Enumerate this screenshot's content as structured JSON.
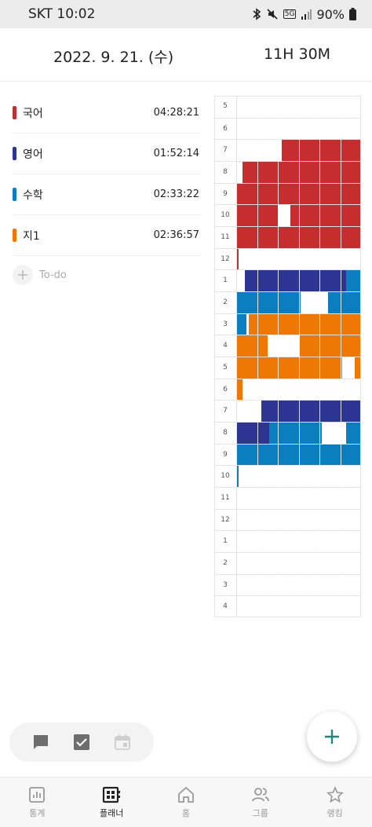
{
  "status_bar": {
    "carrier_time": "SKT 10:02",
    "battery": "90%",
    "network": "5G",
    "icons": [
      "bluetooth-icon",
      "mute-icon",
      "signal-icon",
      "battery-icon"
    ]
  },
  "header": {
    "date": "2022. 9. 21. (수)",
    "total_time": "11H 30M"
  },
  "subjects": [
    {
      "name": "국어",
      "time": "04:28:21",
      "color": "#c62d2e"
    },
    {
      "name": "영어",
      "time": "01:52:14",
      "color": "#2c3591"
    },
    {
      "name": "수학",
      "time": "02:33:22",
      "color": "#0a7ebf"
    },
    {
      "name": "지1",
      "time": "02:36:57",
      "color": "#ef7704"
    }
  ],
  "todo": {
    "label": "To-do"
  },
  "timetable": {
    "hours": [
      "5",
      "6",
      "7",
      "8",
      "9",
      "10",
      "11",
      "12",
      "1",
      "2",
      "3",
      "4",
      "5",
      "6",
      "7",
      "8",
      "9",
      "10",
      "11",
      "12",
      "1",
      "2",
      "3",
      "4"
    ],
    "blocks": [
      {
        "row": 2,
        "start": 2.2,
        "end": 6,
        "subject": 0
      },
      {
        "row": 3,
        "start": 0.3,
        "end": 6,
        "subject": 0
      },
      {
        "row": 4,
        "start": 0,
        "end": 6,
        "subject": 0
      },
      {
        "row": 5,
        "start": 0,
        "end": 2.0,
        "subject": 0
      },
      {
        "row": 5,
        "start": 2.6,
        "end": 6,
        "subject": 0
      },
      {
        "row": 6,
        "start": 0,
        "end": 6,
        "subject": 0
      },
      {
        "row": 7,
        "start": 0,
        "end": 0.1,
        "subject": 0
      },
      {
        "row": 8,
        "start": 0.4,
        "end": 5.3,
        "subject": 1
      },
      {
        "row": 8,
        "start": 5.3,
        "end": 6,
        "subject": 2
      },
      {
        "row": 9,
        "start": 0,
        "end": 3.1,
        "subject": 2
      },
      {
        "row": 9,
        "start": 4.4,
        "end": 6,
        "subject": 2
      },
      {
        "row": 10,
        "start": 0,
        "end": 0.5,
        "subject": 2
      },
      {
        "row": 10,
        "start": 0.6,
        "end": 6,
        "subject": 3
      },
      {
        "row": 11,
        "start": 0,
        "end": 1.5,
        "subject": 3
      },
      {
        "row": 11,
        "start": 3.0,
        "end": 6,
        "subject": 3
      },
      {
        "row": 12,
        "start": 0,
        "end": 5.1,
        "subject": 3
      },
      {
        "row": 12,
        "start": 5.7,
        "end": 6,
        "subject": 3
      },
      {
        "row": 13,
        "start": 0,
        "end": 0.3,
        "subject": 3
      },
      {
        "row": 14,
        "start": 1.2,
        "end": 6,
        "subject": 1
      },
      {
        "row": 15,
        "start": 0,
        "end": 1.6,
        "subject": 1
      },
      {
        "row": 15,
        "start": 1.6,
        "end": 4.1,
        "subject": 2
      },
      {
        "row": 15,
        "start": 5.3,
        "end": 6,
        "subject": 2
      },
      {
        "row": 16,
        "start": 0,
        "end": 6,
        "subject": 2
      },
      {
        "row": 17,
        "start": 0,
        "end": 0.1,
        "subject": 2
      }
    ]
  },
  "pill": {
    "icons": [
      "chat-icon",
      "checkbox-icon",
      "calendar-icon"
    ]
  },
  "fab": {
    "icon": "plus-icon",
    "color": "#1a8a7a"
  },
  "bottom_nav": [
    {
      "label": "통계",
      "icon": "stats-icon",
      "active": false
    },
    {
      "label": "플래너",
      "icon": "planner-icon",
      "active": true
    },
    {
      "label": "홈",
      "icon": "home-icon",
      "active": false
    },
    {
      "label": "그룹",
      "icon": "group-icon",
      "active": false
    },
    {
      "label": "랭킹",
      "icon": "star-icon",
      "active": false
    }
  ]
}
